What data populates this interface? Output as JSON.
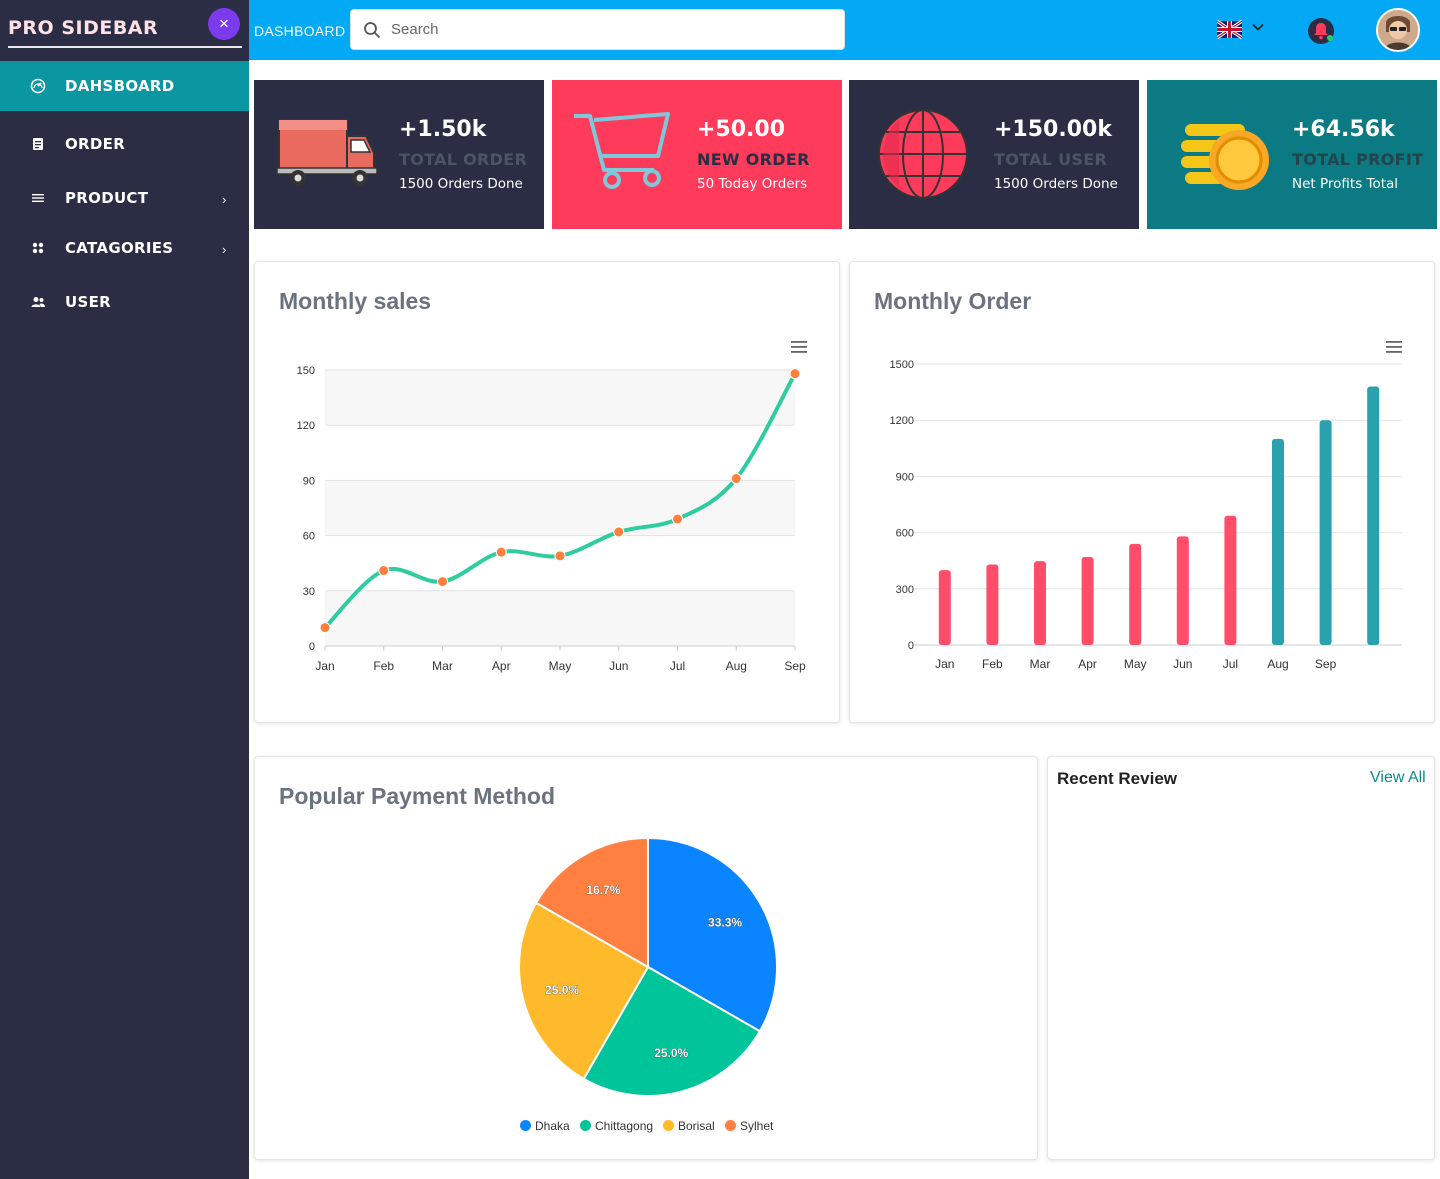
{
  "sidebar": {
    "brand": "PRO SIDEBAR",
    "close_icon_glyph": "×",
    "items": [
      {
        "label": "DAHSBOARD",
        "icon": "dashboard-gauge-icon",
        "active": true,
        "has_arrow": false
      },
      {
        "label": "ORDER",
        "icon": "document-icon",
        "active": false,
        "has_arrow": false
      },
      {
        "label": "PRODUCT",
        "icon": "list-icon",
        "active": false,
        "has_arrow": true
      },
      {
        "label": "CATAGORIES",
        "icon": "grid-icon",
        "active": false,
        "has_arrow": true
      },
      {
        "label": "USER",
        "icon": "users-icon",
        "active": false,
        "has_arrow": false
      }
    ],
    "arrow_glyph": "›"
  },
  "topbar": {
    "breadcrumb": "DASHBOARD",
    "search_placeholder": "Search",
    "search_value": "",
    "language_icon": "uk-flag-icon",
    "notification_icon": "bell-icon"
  },
  "stats": [
    {
      "value": "+1.50k",
      "title": "TOTAL ORDER",
      "subtitle": "1500 Orders Done",
      "icon": "delivery-truck-icon",
      "bg": "#2a2d43",
      "title_color": "#4b5563"
    },
    {
      "value": "+50.00",
      "title": "NEW ORDER",
      "subtitle": "50 Today Orders",
      "icon": "shopping-cart-icon",
      "bg": "#ff3b5c",
      "title_color": "#2a2d43"
    },
    {
      "value": "+150.00k",
      "title": "TOTAL USER",
      "subtitle": "1500 Orders Done",
      "icon": "globe-icon",
      "bg": "#2a2d43",
      "title_color": "#4b5563"
    },
    {
      "value": "+64.56k",
      "title": "TOTAL PROFIT",
      "subtitle": "Net Profits Total",
      "icon": "coins-icon",
      "bg": "#0b7a83",
      "title_color": "#23444a"
    }
  ],
  "monthly_sales": {
    "title": "Monthly sales"
  },
  "monthly_order": {
    "title": "Monthly Order"
  },
  "payment": {
    "title": "Popular Payment Method"
  },
  "review": {
    "title": "Recent Review",
    "link": "View All"
  },
  "chart_data": [
    {
      "type": "line",
      "title": "Monthly sales",
      "categories": [
        "Jan",
        "Feb",
        "Mar",
        "Apr",
        "May",
        "Jun",
        "Jul",
        "Aug",
        "Sep"
      ],
      "series": [
        {
          "values": [
            10,
            41,
            35,
            51,
            49,
            62,
            69,
            91,
            148
          ]
        }
      ],
      "ylim": [
        0,
        150
      ],
      "yticks": [
        0,
        30,
        60,
        90,
        120,
        150
      ],
      "line_color": "#2ecc9f",
      "marker_color": "#ff7f3f",
      "grid": true
    },
    {
      "type": "bar",
      "title": "Monthly Order",
      "categories": [
        "Jan",
        "Feb",
        "Mar",
        "Apr",
        "May",
        "Jun",
        "Jul",
        "Aug",
        "Sep"
      ],
      "values": [
        400,
        430,
        448,
        470,
        540,
        580,
        690,
        1100,
        1200,
        1380
      ],
      "ylim": [
        0,
        1500
      ],
      "yticks": [
        0,
        300,
        600,
        900,
        1200,
        1500
      ],
      "bar_colors": [
        "#ff4d6a",
        "#ff4d6a",
        "#ff4d6a",
        "#ff4d6a",
        "#ff4d6a",
        "#ff4d6a",
        "#ff4d6a",
        "#2aa2ad",
        "#2aa2ad",
        "#2aa2ad"
      ],
      "grid": true
    },
    {
      "type": "pie",
      "title": "Popular Payment Method",
      "labels": [
        "Dhaka",
        "Chittagong",
        "Borisal",
        "Sylhet"
      ],
      "values": [
        33.3,
        25.0,
        25.0,
        16.7
      ],
      "data_labels": [
        "33.3%",
        "25.0%",
        "25.0%",
        "16.7%"
      ],
      "colors": [
        "#0a84ff",
        "#00c49a",
        "#ffba2c",
        "#ff8040"
      ],
      "legend": "bottom"
    }
  ]
}
